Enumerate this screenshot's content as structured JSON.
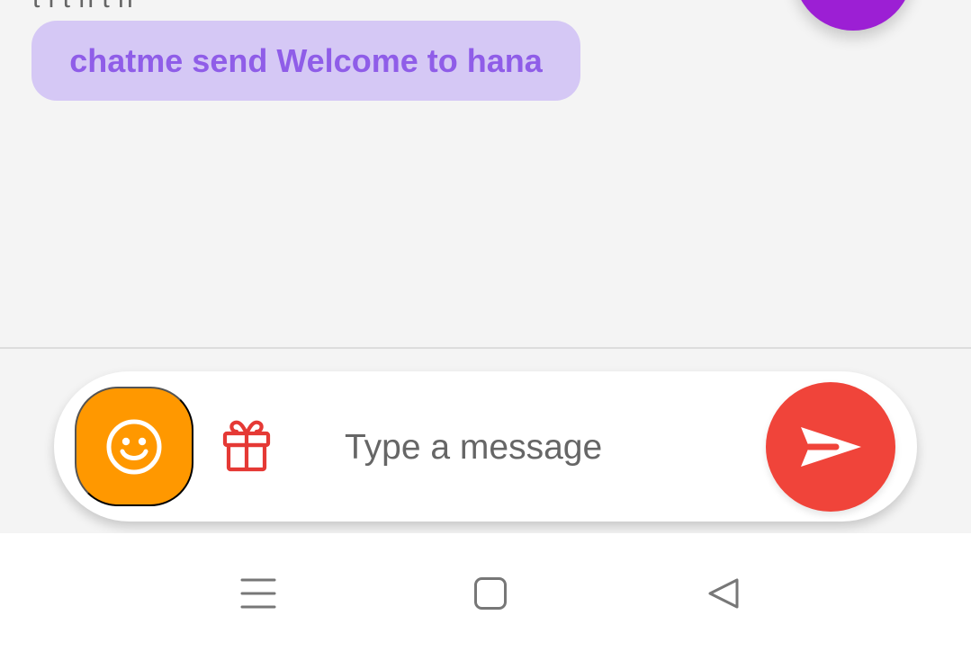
{
  "chat": {
    "partial_text": "t   l  t   h      t  h   ",
    "message_chip": {
      "text": "chatme send Welcome to hana"
    }
  },
  "composer": {
    "placeholder": "Type a message"
  },
  "icons": {
    "emoji": "smile-icon",
    "gift": "gift-icon",
    "send": "send-icon",
    "menu": "menu-icon",
    "home": "home-icon",
    "back": "back-icon"
  },
  "colors": {
    "background": "#f4f4f4",
    "message_chip_bg": "#d5c8f5",
    "message_chip_text": "#8f5de8",
    "emoji_button": "#ff9800",
    "send_button": "#f0443a",
    "gift_icon": "#e53935",
    "purple_fab": "#9c1fd4",
    "nav_icons": "#777777"
  }
}
